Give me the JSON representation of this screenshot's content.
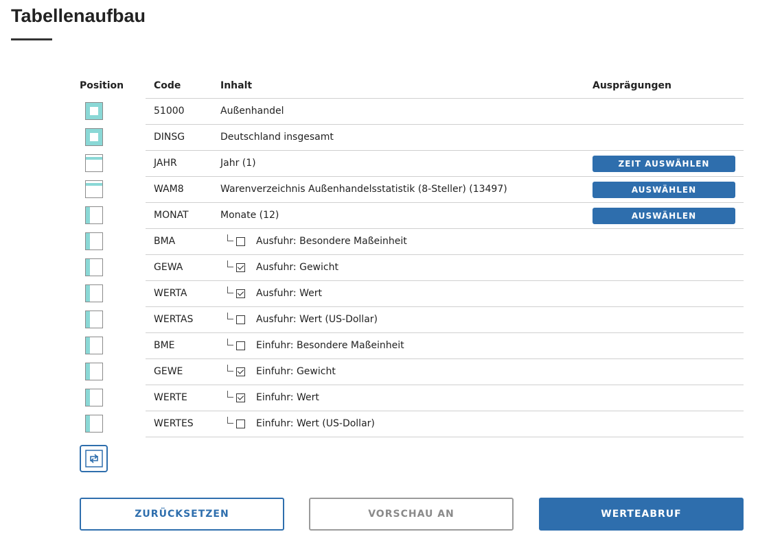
{
  "page": {
    "title": "Tabellenaufbau"
  },
  "table": {
    "headers": {
      "position": "Position",
      "code": "Code",
      "inhalt": "Inhalt",
      "auspraegungen": "Ausprägungen"
    },
    "rows": [
      {
        "code": "51000",
        "inhalt": "Außenhandel",
        "position_style": "full"
      },
      {
        "code": "DINSG",
        "inhalt": "Deutschland insgesamt",
        "position_style": "full"
      },
      {
        "code": "JAHR",
        "inhalt": "Jahr (1)",
        "position_style": "top",
        "action": "ZEIT AUSWÄHLEN"
      },
      {
        "code": "WAM8",
        "inhalt": "Warenverzeichnis Außenhandelsstatistik (8-Steller) (13497)",
        "position_style": "top",
        "action": "AUSWÄHLEN"
      },
      {
        "code": "MONAT",
        "inhalt": "Monate (12)",
        "position_style": "left",
        "action": "AUSWÄHLEN"
      },
      {
        "code": "BMA",
        "inhalt": "Ausfuhr: Besondere Maßeinheit",
        "position_style": "left",
        "checked": false
      },
      {
        "code": "GEWA",
        "inhalt": "Ausfuhr: Gewicht",
        "position_style": "left",
        "checked": true
      },
      {
        "code": "WERTA",
        "inhalt": "Ausfuhr: Wert",
        "position_style": "left",
        "checked": true
      },
      {
        "code": "WERTAS",
        "inhalt": "Ausfuhr: Wert (US-Dollar)",
        "position_style": "left",
        "checked": false
      },
      {
        "code": "BME",
        "inhalt": "Einfuhr: Besondere Maßeinheit",
        "position_style": "left",
        "checked": false
      },
      {
        "code": "GEWE",
        "inhalt": "Einfuhr: Gewicht",
        "position_style": "left",
        "checked": true
      },
      {
        "code": "WERTE",
        "inhalt": "Einfuhr: Wert",
        "position_style": "left",
        "checked": true
      },
      {
        "code": "WERTES",
        "inhalt": "Einfuhr: Wert (US-Dollar)",
        "position_style": "left",
        "checked": false
      }
    ]
  },
  "swap": {
    "icon": "swap-arrows-icon"
  },
  "buttons": {
    "reset": "ZURÜCKSETZEN",
    "preview": "VORSCHAU AN",
    "fetch": "WERTEABRUF"
  },
  "colors": {
    "accent": "#2e6ead",
    "position_fill": "#8ad8d6",
    "disabled": "#9a9a9a"
  }
}
